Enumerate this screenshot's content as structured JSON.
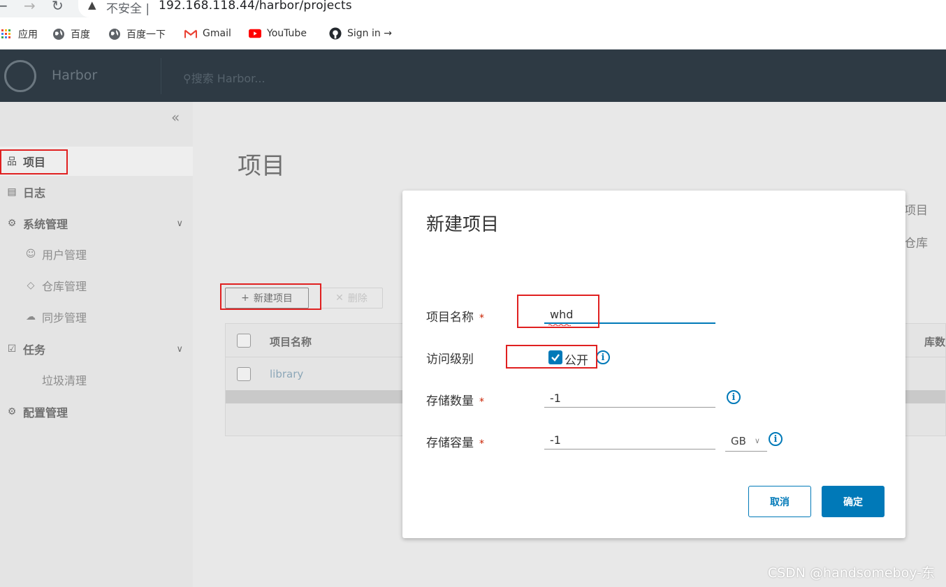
{
  "browser": {
    "security_label": "不安全",
    "url": "192.168.118.44/harbor/projects",
    "bookmarks": [
      "应用",
      "百度",
      "百度一下",
      "Gmail",
      "YouTube",
      "Sign in →"
    ]
  },
  "header": {
    "brand": "Harbor",
    "search_placeholder": "搜索 Harbor..."
  },
  "sidebar": {
    "items": [
      {
        "label": "项目"
      },
      {
        "label": "日志"
      },
      {
        "label": "系统管理"
      },
      {
        "label": "用户管理"
      },
      {
        "label": "仓库管理"
      },
      {
        "label": "同步管理"
      },
      {
        "label": "任务"
      },
      {
        "label": "垃圾清理"
      },
      {
        "label": "配置管理"
      }
    ]
  },
  "main": {
    "title": "项目",
    "right_fragments": [
      "项目",
      "仓库"
    ],
    "new_button": "新建项目",
    "delete_button": "删除",
    "table": {
      "col_name": "项目名称",
      "col_right": "库数",
      "rows": [
        "library"
      ]
    }
  },
  "modal": {
    "title": "新建项目",
    "fields": {
      "name_label": "项目名称",
      "name_value": "whd",
      "access_label": "访问级别",
      "public_label": "公开",
      "count_label": "存储数量",
      "count_value": "-1",
      "capacity_label": "存储容量",
      "capacity_value": "-1",
      "capacity_unit": "GB",
      "required_mark": "*"
    },
    "cancel": "取消",
    "ok": "确定"
  },
  "watermark": "CSDN @handsomeboy-东",
  "colors": {
    "accent": "#0079b8",
    "header": "#2e3a44",
    "annotation": "#e02020"
  }
}
